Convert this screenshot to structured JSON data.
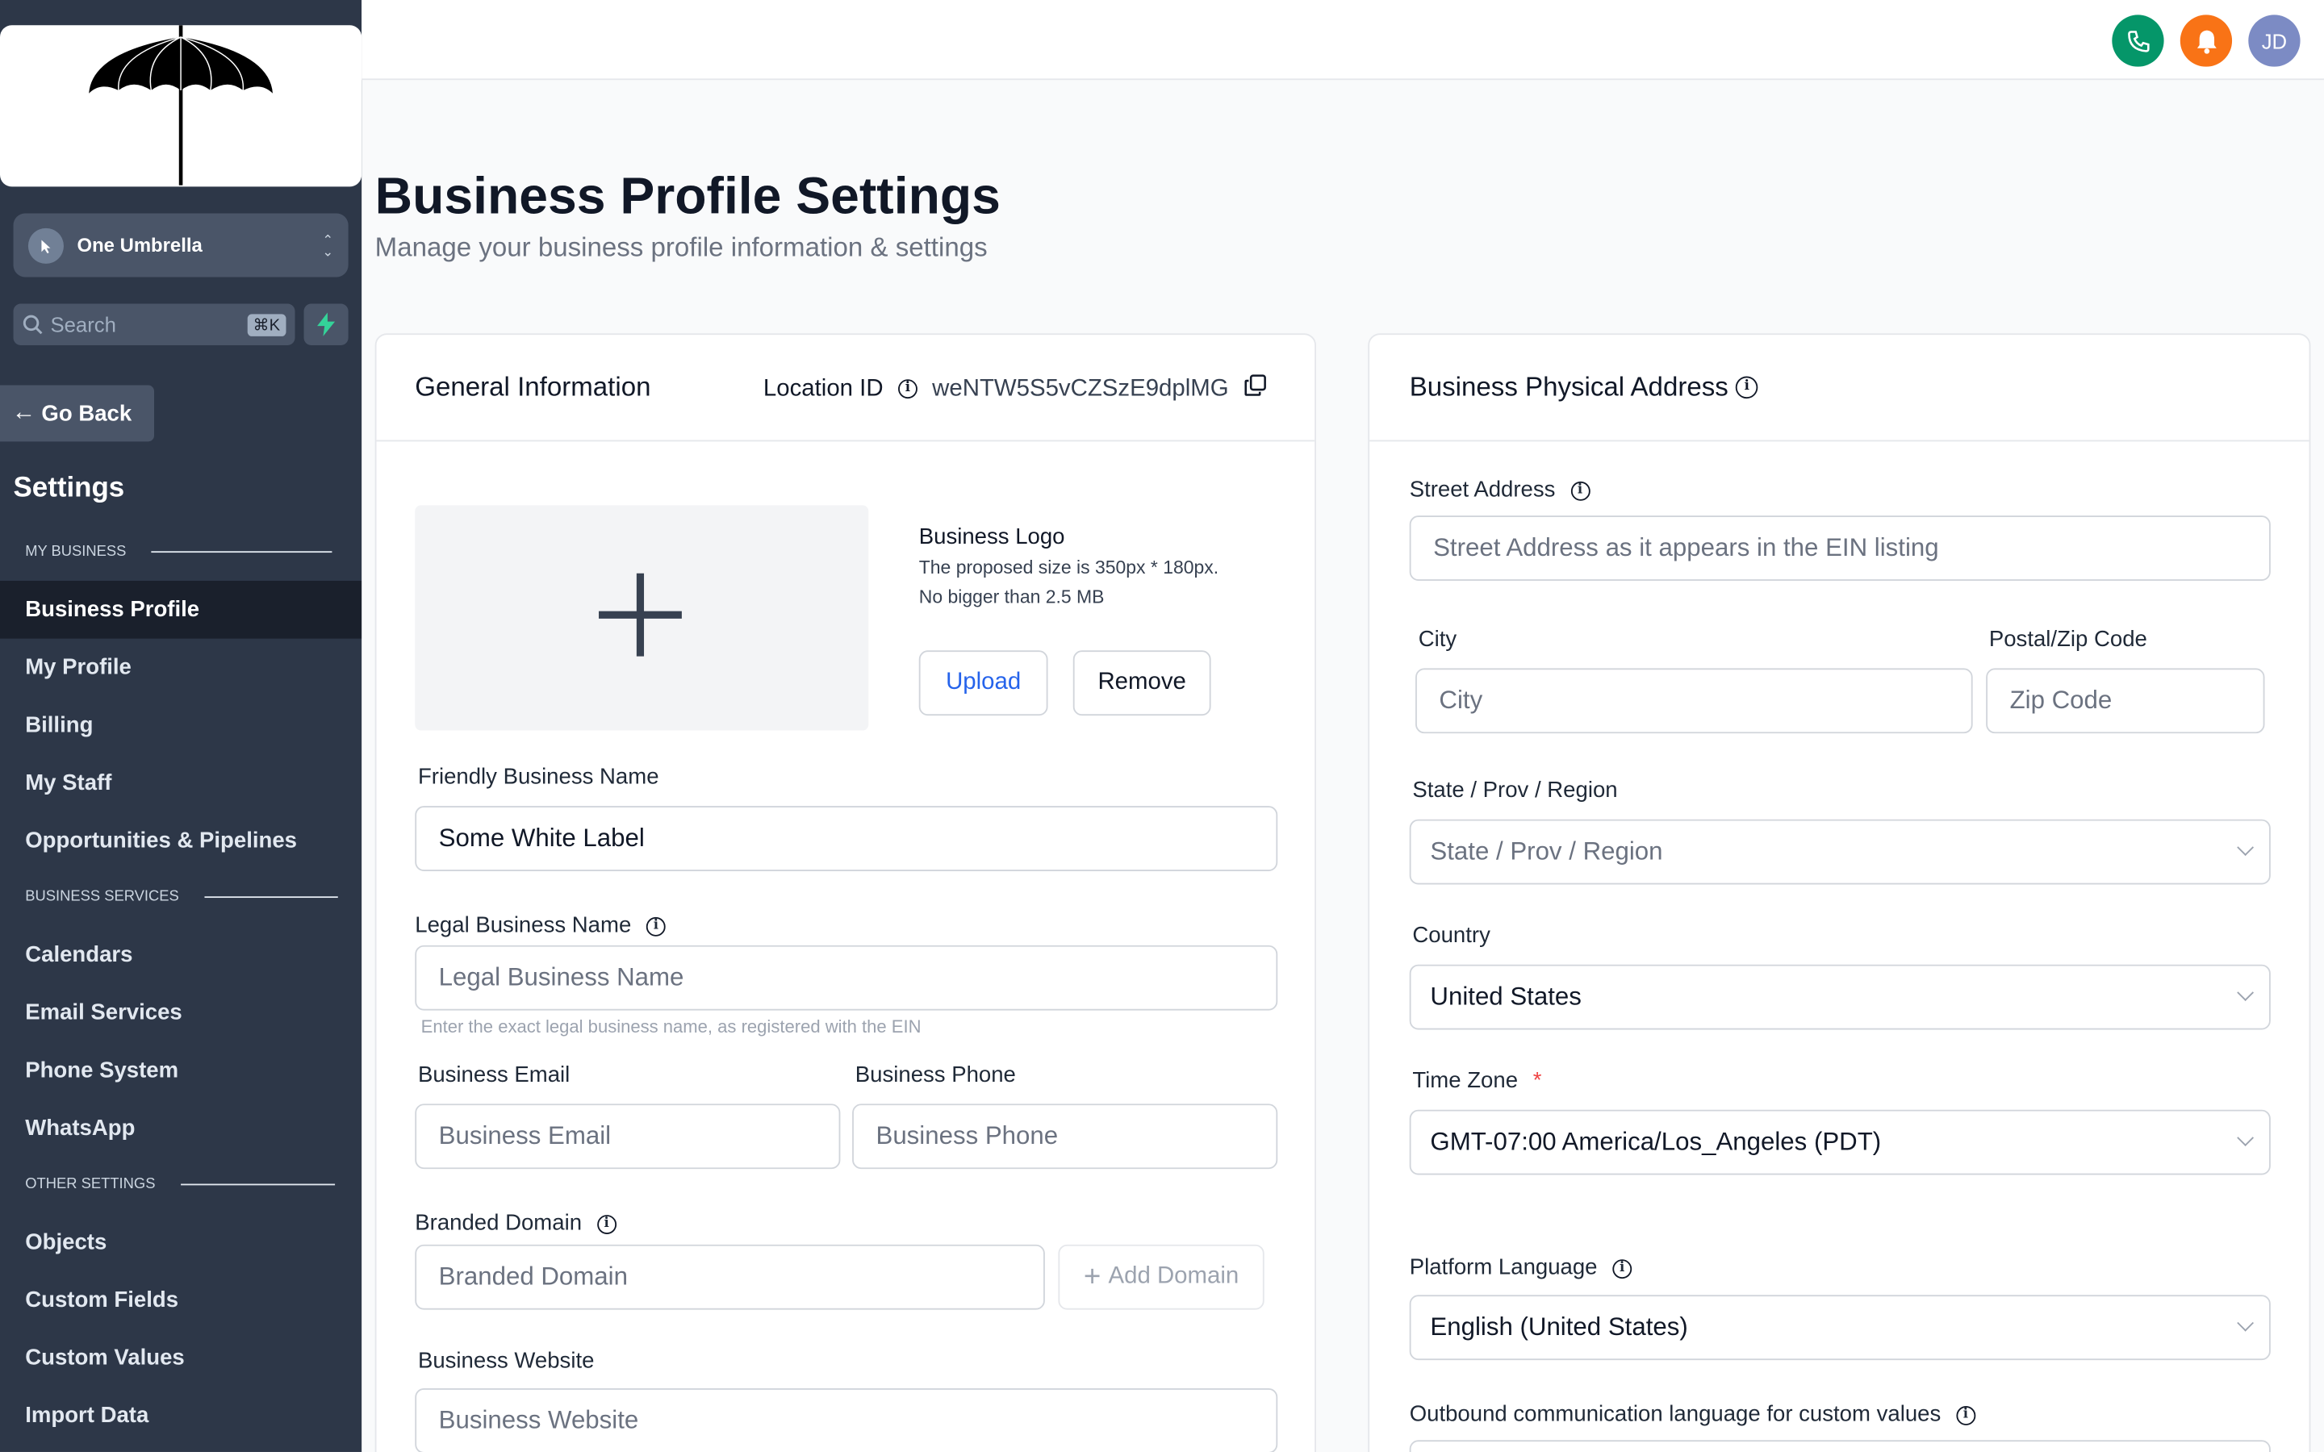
{
  "sidebar": {
    "account_name": "One Umbrella",
    "search_label": "Search",
    "search_shortcut": "⌘K",
    "go_back": "Go Back",
    "settings_title": "Settings",
    "sections": {
      "my_business": "MY BUSINESS",
      "business_services": "BUSINESS SERVICES",
      "other_settings": "OTHER SETTINGS"
    },
    "items": [
      {
        "label": "Business Profile",
        "active": true
      },
      {
        "label": "My Profile"
      },
      {
        "label": "Billing"
      },
      {
        "label": "My Staff"
      },
      {
        "label": "Opportunities & Pipelines"
      },
      {
        "label": "Calendars"
      },
      {
        "label": "Email Services"
      },
      {
        "label": "Phone System"
      },
      {
        "label": "WhatsApp"
      },
      {
        "label": "Objects"
      },
      {
        "label": "Custom Fields"
      },
      {
        "label": "Custom Values"
      },
      {
        "label": "Import Data"
      }
    ]
  },
  "topbar": {
    "avatar_initials": "JD",
    "colors": {
      "phone": "#059669",
      "bell": "#f97316",
      "avatar": "#7c8bc4"
    }
  },
  "page": {
    "title": "Business Profile Settings",
    "subtitle": "Manage your business profile information & settings"
  },
  "general": {
    "title": "General Information",
    "location_label": "Location ID",
    "location_id": "weNTW5S5vCZSzE9dplMG",
    "logo_title": "Business Logo",
    "logo_hint_1": "The proposed size is 350px * 180px.",
    "logo_hint_2": "No bigger than 2.5 MB",
    "upload": "Upload",
    "remove": "Remove",
    "friendly_label": "Friendly Business Name",
    "friendly_value": "Some White Label",
    "legal_label": "Legal Business Name",
    "legal_placeholder": "Legal Business Name",
    "legal_hint": "Enter the exact legal business name, as registered with the EIN",
    "email_label": "Business Email",
    "email_placeholder": "Business Email",
    "phone_label": "Business Phone",
    "phone_placeholder": "Business Phone",
    "domain_label": "Branded Domain",
    "domain_placeholder": "Branded Domain",
    "add_domain": "Add Domain",
    "website_label": "Business Website",
    "website_placeholder": "Business Website"
  },
  "address": {
    "title": "Business Physical Address",
    "street_label": "Street Address",
    "street_placeholder": "Street Address as it appears in the EIN listing",
    "city_label": "City",
    "city_placeholder": "City",
    "zip_label": "Postal/Zip Code",
    "zip_placeholder": "Zip Code",
    "state_label": "State / Prov / Region",
    "state_placeholder": "State / Prov / Region",
    "country_label": "Country",
    "country_value": "United States",
    "timezone_label": "Time Zone",
    "timezone_required": "*",
    "timezone_value": "GMT-07:00 America/Los_Angeles (PDT)",
    "language_label": "Platform Language",
    "language_value": "English (United States)",
    "outbound_label": "Outbound communication language for custom values"
  }
}
